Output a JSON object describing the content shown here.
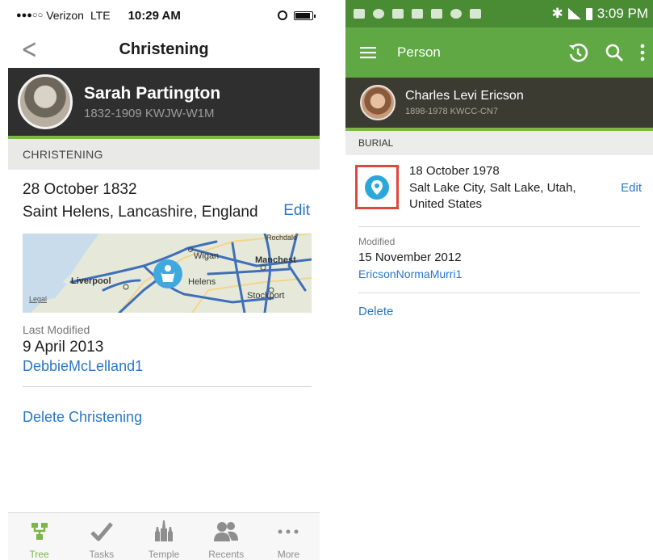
{
  "ios": {
    "status": {
      "signal": "●●●○○",
      "carrier": "Verizon",
      "network": "LTE",
      "time": "10:29 AM"
    },
    "nav": {
      "back": "<",
      "title": "Christening"
    },
    "person": {
      "name": "Sarah Partington",
      "meta": "1832-1909  KWJW-W1M"
    },
    "section": "CHRISTENING",
    "event": {
      "date": "28 October 1832",
      "place": "Saint Helens, Lancashire, England",
      "edit": "Edit"
    },
    "map": {
      "labels": {
        "wigan": "Wigan",
        "manchester": "Manchest",
        "liverpool": "Liverpool",
        "helens": "Helens",
        "stockport": "Stockport",
        "rochdale": "Rochdale",
        "legal": "Legal"
      }
    },
    "modified": {
      "label": "Last Modified",
      "date": "9 April 2013",
      "user": "DebbieMcLelland1"
    },
    "delete": "Delete Christening",
    "tabs": [
      {
        "label": "Tree",
        "icon": "tree-icon"
      },
      {
        "label": "Tasks",
        "icon": "checkmark-icon"
      },
      {
        "label": "Temple",
        "icon": "temple-icon"
      },
      {
        "label": "Recents",
        "icon": "people-icon"
      },
      {
        "label": "More",
        "icon": "more-dots-icon"
      }
    ],
    "colors": {
      "accent": "#7ab648",
      "link": "#2a77c9",
      "header": "#2f2f2f"
    }
  },
  "android": {
    "status": {
      "time": "3:09 PM"
    },
    "toolbar": {
      "title": "Person"
    },
    "person": {
      "name": "Charles Levi Ericson",
      "meta": "1898-1978   KWCC-CN7"
    },
    "section": "BURIAL",
    "event": {
      "date": "18 October 1978",
      "place": "Salt Lake City, Salt Lake, Utah, United States",
      "edit": "Edit"
    },
    "modified": {
      "label": "Modified",
      "date": "15 November 2012",
      "user": "EricsonNormaMurri1"
    },
    "delete": "Delete",
    "colors": {
      "toolbar": "#5fa843",
      "statusbar": "#4a8c34",
      "marker": "#2aa9d9",
      "highlight": "#e0463b"
    }
  }
}
